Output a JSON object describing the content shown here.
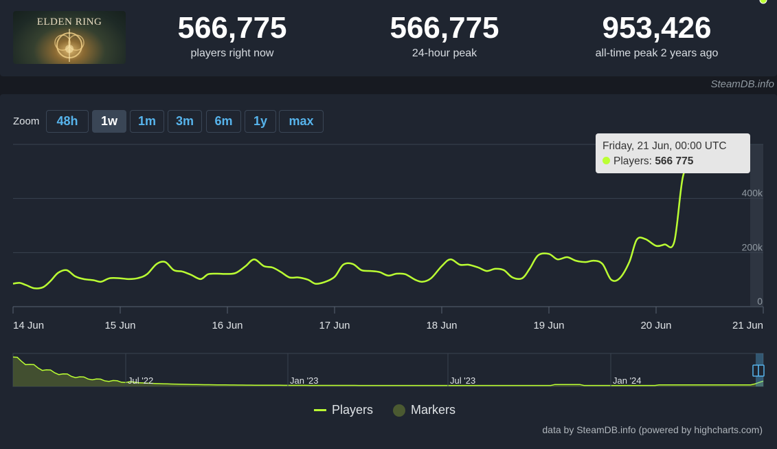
{
  "game": {
    "logo_text": "ELDEN RING"
  },
  "stats": [
    {
      "value": "566,775",
      "label": "players right now"
    },
    {
      "value": "566,775",
      "label": "24-hour peak"
    },
    {
      "value": "953,426",
      "label": "all-time peak 2 years ago"
    }
  ],
  "credit_top": "SteamDB.info",
  "zoom": {
    "label": "Zoom",
    "buttons": [
      "48h",
      "1w",
      "1m",
      "3m",
      "6m",
      "1y",
      "max"
    ],
    "active": "1w"
  },
  "tooltip": {
    "header": "Friday, 21 Jun, 00:00 UTC",
    "series_label": "Players:",
    "value": "566 775"
  },
  "legend": {
    "players": "Players",
    "markers": "Markers"
  },
  "credit_bottom": "data by SteamDB.info (powered by highcharts.com)",
  "colors": {
    "line": "#bbff33",
    "background": "#1f2530",
    "grid": "#3a4350",
    "accent_blue": "#57b4ec"
  },
  "chart_data": {
    "type": "line",
    "series_name": "Players",
    "x_start": "14 Jun",
    "x_end": "21 Jun",
    "xtick_labels": [
      "14 Jun",
      "15 Jun",
      "16 Jun",
      "17 Jun",
      "18 Jun",
      "19 Jun",
      "20 Jun",
      "21 Jun"
    ],
    "ytick_labels": [
      "0",
      "200k",
      "400k"
    ],
    "ylim": [
      0,
      600000
    ],
    "grid": true,
    "x_days": [
      0,
      0.06,
      0.12,
      0.2,
      0.28,
      0.35,
      0.42,
      0.5,
      0.58,
      0.66,
      0.75,
      0.82,
      0.9,
      1,
      1.08,
      1.17,
      1.25,
      1.34,
      1.42,
      1.5,
      1.58,
      1.66,
      1.75,
      1.82,
      1.9,
      2,
      2.08,
      2.17,
      2.25,
      2.34,
      2.42,
      2.5,
      2.58,
      2.66,
      2.75,
      2.82,
      2.9,
      3,
      3.08,
      3.17,
      3.25,
      3.34,
      3.42,
      3.5,
      3.58,
      3.66,
      3.75,
      3.82,
      3.9,
      4,
      4.08,
      4.17,
      4.25,
      4.34,
      4.42,
      4.5,
      4.58,
      4.66,
      4.75,
      4.82,
      4.9,
      5,
      5.08,
      5.17,
      5.25,
      5.34,
      5.42,
      5.5,
      5.58,
      5.66,
      5.75,
      5.82,
      5.9,
      6,
      6.08,
      6.17,
      6.25,
      6.34,
      6.42,
      6.5,
      6.58,
      6.66,
      6.75,
      6.82,
      6.9,
      6.95,
      6.98,
      7
    ],
    "values": [
      85000,
      88000,
      80000,
      68000,
      72000,
      95000,
      125000,
      135000,
      112000,
      102000,
      98000,
      92000,
      105000,
      105000,
      102000,
      106000,
      120000,
      158000,
      165000,
      135000,
      130000,
      118000,
      102000,
      120000,
      122000,
      121000,
      125000,
      150000,
      175000,
      150000,
      145000,
      128000,
      108000,
      108000,
      100000,
      85000,
      90000,
      110000,
      155000,
      158000,
      135000,
      132000,
      128000,
      115000,
      122000,
      120000,
      100000,
      92000,
      105000,
      150000,
      175000,
      155000,
      155000,
      145000,
      132000,
      140000,
      135000,
      108000,
      105000,
      140000,
      190000,
      195000,
      175000,
      183000,
      170000,
      165000,
      170000,
      158000,
      100000,
      105000,
      165000,
      248000,
      250000,
      225000,
      230000,
      240000,
      480000,
      540000,
      566775
    ],
    "navigator": {
      "xtick_labels": [
        "Jul '22",
        "Jan '23",
        "Jul '23",
        "Jan '24"
      ]
    }
  }
}
